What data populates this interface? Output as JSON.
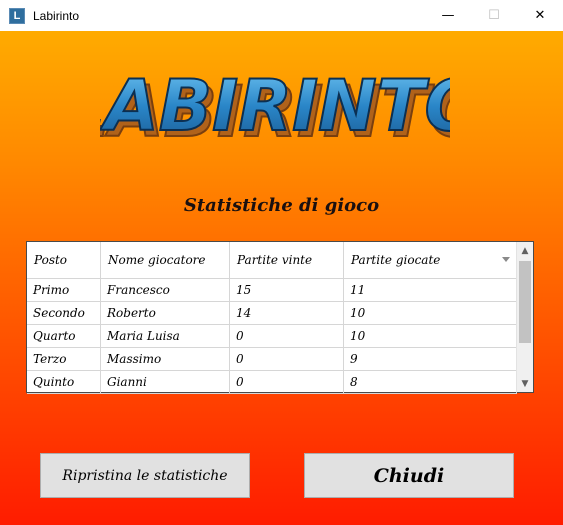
{
  "window": {
    "title": "Labirinto",
    "icon_letter": "L",
    "minimize_glyph": "—",
    "maximize_glyph": "☐",
    "close_glyph": "✕"
  },
  "logo": {
    "text": "LABIRINTO",
    "fill_color": "#2a86c8",
    "outline_color": "#d8a040"
  },
  "heading": "Statistiche di gioco",
  "table": {
    "columns": [
      "Posto",
      "Nome giocatore",
      "Partite vinte",
      "Partite giocate"
    ],
    "rows": [
      [
        "Primo",
        "Francesco",
        "15",
        "11"
      ],
      [
        "Secondo",
        "Roberto",
        "14",
        "10"
      ],
      [
        "Quarto",
        "Maria Luisa",
        "0",
        "10"
      ],
      [
        "Terzo",
        "Massimo",
        "0",
        "9"
      ],
      [
        "Quinto",
        "Gianni",
        "0",
        "8"
      ]
    ]
  },
  "buttons": {
    "reset_label": "Ripristina le statistiche",
    "close_label": "Chiudi"
  },
  "colors": {
    "background_top": "#ffb300",
    "background_bottom": "#ff1c00"
  }
}
